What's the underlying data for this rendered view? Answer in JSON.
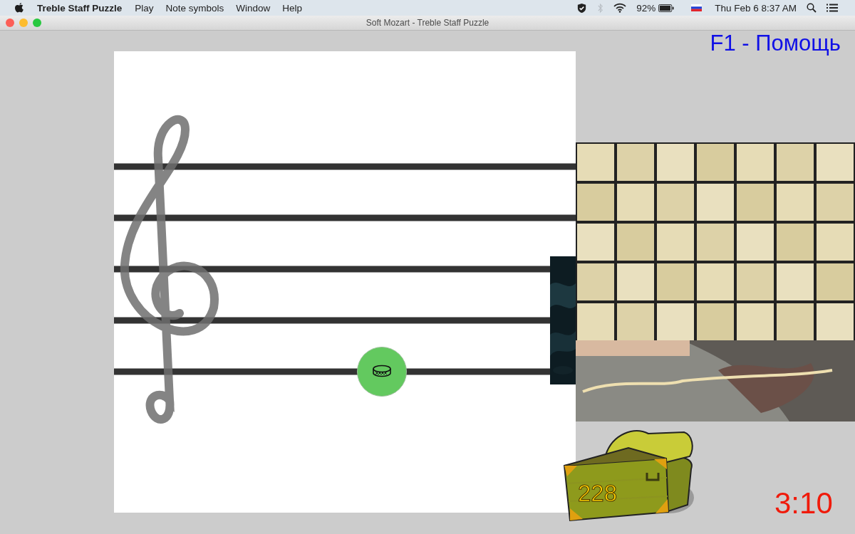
{
  "menu_bar": {
    "app_name": "Treble Staff Puzzle",
    "items": [
      "Play",
      "Note symbols",
      "Window",
      "Help"
    ],
    "battery": "92%",
    "clock": "Thu Feb 6  8:37 AM"
  },
  "window": {
    "title": "Soft Mozart - Treble Staff Puzzle"
  },
  "help_hint": "F1 - Помощь",
  "score": "228",
  "timer": "3:10"
}
